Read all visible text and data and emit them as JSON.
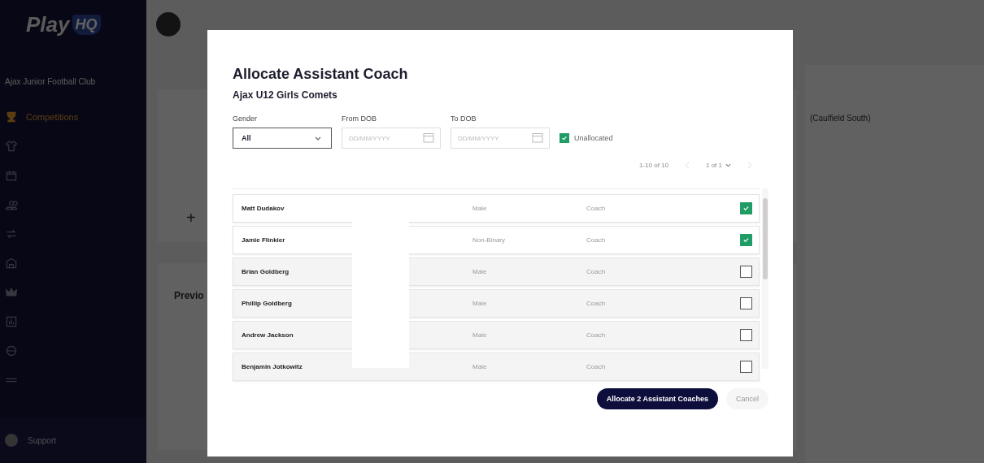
{
  "sidebar": {
    "logo": {
      "text": "Play",
      "badge": "HQ"
    },
    "org_label": "Ajax Junior Football Club",
    "items": [
      {
        "label": "Competitions",
        "selected": true
      },
      {
        "selected": false
      },
      {
        "selected": false
      },
      {
        "selected": false
      },
      {
        "selected": false
      },
      {
        "selected": false
      },
      {
        "selected": false
      },
      {
        "selected": false
      },
      {
        "selected": false
      },
      {
        "selected": false
      }
    ],
    "support": "Support"
  },
  "background": {
    "add": "+",
    "section_heading": "Previo",
    "venue": "(Caulfield South)"
  },
  "modal": {
    "title": "Allocate Assistant Coach",
    "subtitle": "Ajax U12 Girls Comets",
    "filters": {
      "gender": {
        "label": "Gender",
        "value": "All"
      },
      "from_dob": {
        "label": "From DOB",
        "placeholder": "DD/MM/YYYY"
      },
      "to_dob": {
        "label": "To DOB",
        "placeholder": "DD/MM/YYYY"
      },
      "unallocated": {
        "label": "Unallocated",
        "checked": true
      }
    },
    "pagination": {
      "range": "1-10 of 10",
      "page": "1 of 1"
    },
    "rows": [
      {
        "name": "Matt Dudakov",
        "gender": "Male",
        "role": "Coach",
        "checked": true
      },
      {
        "name": "Jamie Flinkier",
        "gender": "Non-Binary",
        "role": "Coach",
        "checked": true
      },
      {
        "name": "Brian Goldberg",
        "gender": "Male",
        "role": "Coach",
        "checked": false
      },
      {
        "name": "Phillip Goldberg",
        "gender": "Male",
        "role": "Coach",
        "checked": false
      },
      {
        "name": "Andrew Jackson",
        "gender": "Male",
        "role": "Coach",
        "checked": false
      },
      {
        "name": "Benjamin Jotkowitz",
        "gender": "Male",
        "role": "Coach",
        "checked": false
      }
    ],
    "buttons": {
      "primary": "Allocate 2 Assistant Coaches",
      "cancel": "Cancel"
    }
  }
}
